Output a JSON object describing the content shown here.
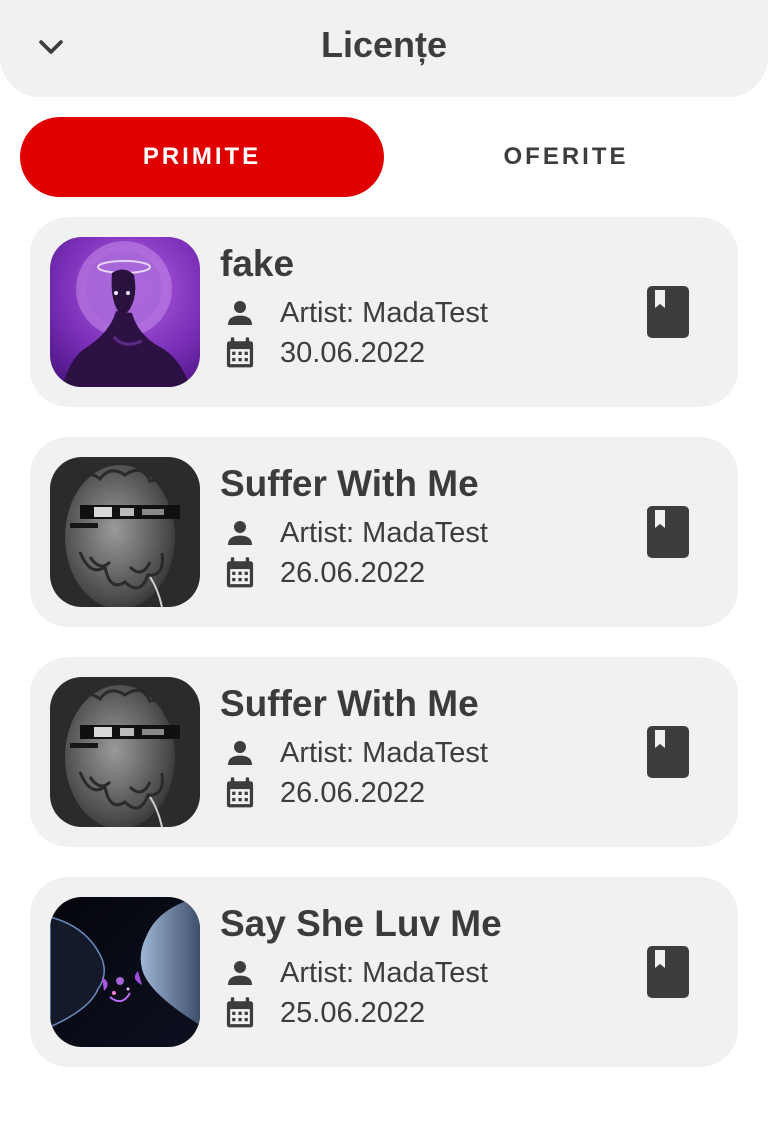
{
  "header": {
    "title": "Licențe",
    "back_icon": "chevron-down-icon"
  },
  "tabs": [
    {
      "label": "PRIMITE",
      "active": true
    },
    {
      "label": "OFERITE",
      "active": false
    }
  ],
  "colors": {
    "accent": "#e00000",
    "card_bg": "#f1f1f1",
    "text": "#3d3d3d"
  },
  "licenses": [
    {
      "title": "fake",
      "artist": "Artist: MadaTest",
      "date": "30.06.2022",
      "cover": "purple-figure-artwork"
    },
    {
      "title": "Suffer With Me",
      "artist": "Artist: MadaTest",
      "date": "26.06.2022",
      "cover": "statue-glitch-artwork"
    },
    {
      "title": "Suffer With Me",
      "artist": "Artist: MadaTest",
      "date": "26.06.2022",
      "cover": "statue-glitch-artwork"
    },
    {
      "title": "Say She Luv Me",
      "artist": "Artist: MadaTest",
      "date": "25.06.2022",
      "cover": "faces-kiss-artwork"
    }
  ]
}
